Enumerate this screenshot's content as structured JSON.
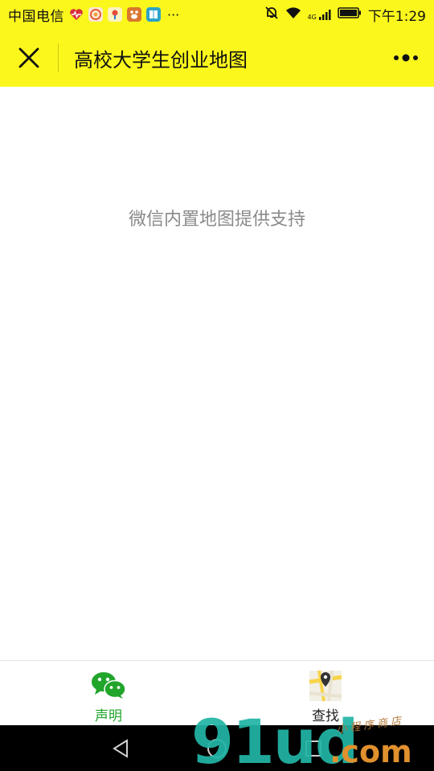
{
  "status_bar": {
    "carrier": "中国电信",
    "time": "下午1:29",
    "more_indicator": "···",
    "network": "4G",
    "icons": [
      "heart-rate-icon",
      "weibo-icon",
      "location-app-icon",
      "baidu-app-icon",
      "reader-app-icon",
      "mute-icon",
      "wifi-icon",
      "signal-icon",
      "battery-icon"
    ]
  },
  "title_bar": {
    "title": "高校大学生创业地图",
    "close_icon": "close-icon",
    "more_icon": "more-icon",
    "background": "#fbf71d"
  },
  "content": {
    "notice": "微信内置地图提供支持"
  },
  "tab_bar": {
    "tabs": [
      {
        "label": "声明",
        "icon": "wechat-icon",
        "active": true,
        "color": "#21a52b"
      },
      {
        "label": "查找",
        "icon": "map-pin-icon",
        "active": false,
        "color": "#222222"
      }
    ]
  },
  "watermark": {
    "digits": "91ud",
    "suffix": ".com",
    "script": "小程序商店"
  }
}
